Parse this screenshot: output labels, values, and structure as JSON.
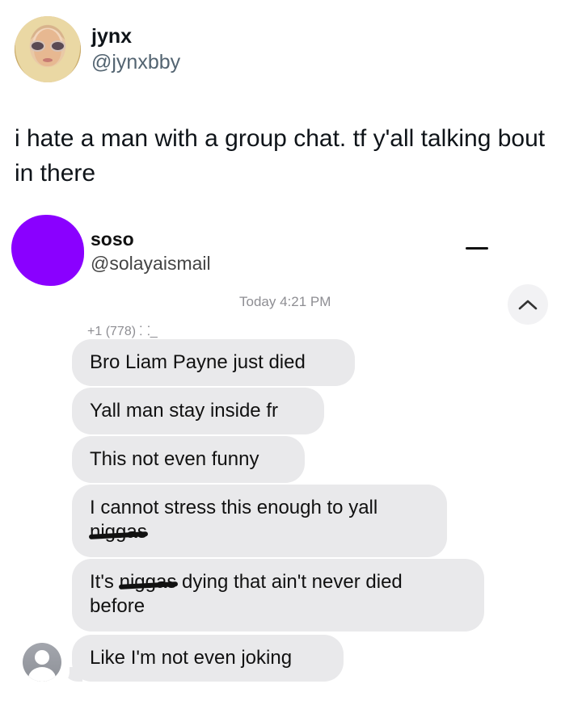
{
  "tweet": {
    "author_name": "jynx",
    "author_handle": "@jynxbby",
    "text": "i hate a man with a group chat. tf y'all talking bout in there"
  },
  "quoted": {
    "author_name": "soso",
    "author_handle": "@solayaismail",
    "timestamp": "Today 4:21 PM",
    "sender": "+1 (778) ⸬ ̲",
    "messages": [
      {
        "text": "Bro Liam Payne just died"
      },
      {
        "text": "Yall man stay inside fr"
      },
      {
        "text": "This not even funny"
      },
      {
        "line1": "I cannot stress this enough to yall",
        "redacted": "niggas"
      },
      {
        "prefix": "It's ",
        "redacted": "niggas",
        "suffix": " dying that ain't never died",
        "line2": "before"
      },
      {
        "text": "Like I'm not even joking"
      }
    ]
  },
  "icons": {
    "author_avatar": "profile-photo",
    "quoted_avatar": "purple-scribble-avatar",
    "up_chevron": "chevron-up-icon",
    "contact_avatar": "person-icon"
  },
  "colors": {
    "bubble_bg": "#e9e9eb",
    "purple": "#8a00ff",
    "secondary_text": "#536471"
  }
}
